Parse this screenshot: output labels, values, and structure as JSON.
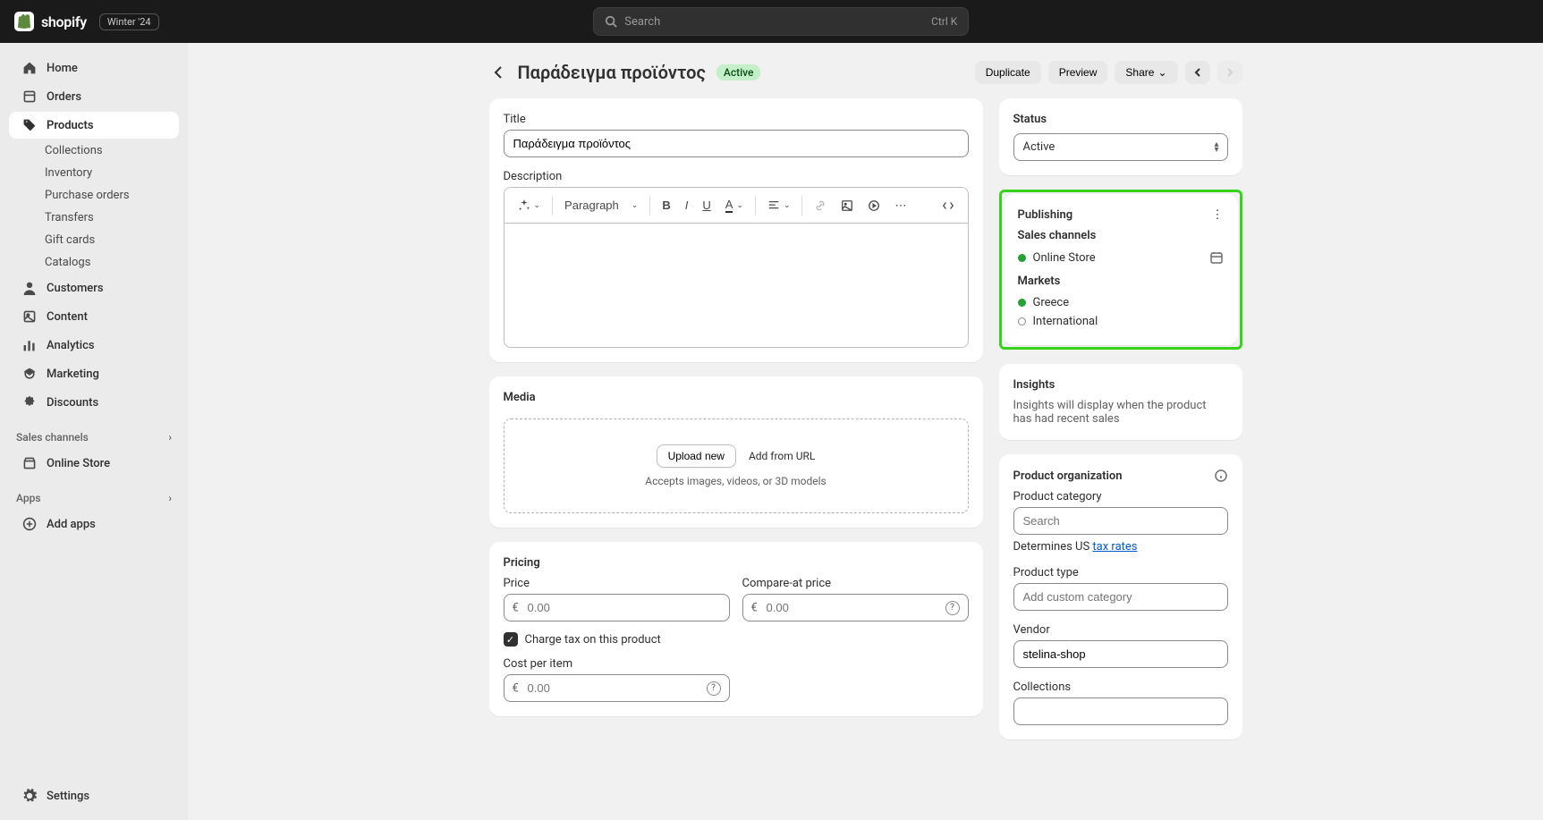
{
  "topbar": {
    "brand": "shopify",
    "version_pill": "Winter '24",
    "search_placeholder": "Search",
    "search_shortcut": "Ctrl K"
  },
  "sidebar": {
    "items": [
      {
        "label": "Home",
        "icon": "home"
      },
      {
        "label": "Orders",
        "icon": "orders"
      },
      {
        "label": "Products",
        "icon": "products",
        "active": true
      }
    ],
    "sub_items": [
      "Collections",
      "Inventory",
      "Purchase orders",
      "Transfers",
      "Gift cards",
      "Catalogs"
    ],
    "items2": [
      {
        "label": "Customers",
        "icon": "customers"
      },
      {
        "label": "Content",
        "icon": "content"
      },
      {
        "label": "Analytics",
        "icon": "analytics"
      },
      {
        "label": "Marketing",
        "icon": "marketing"
      },
      {
        "label": "Discounts",
        "icon": "discounts"
      }
    ],
    "sales_channels_label": "Sales channels",
    "online_store": "Online Store",
    "apps_label": "Apps",
    "add_apps": "Add apps",
    "settings": "Settings"
  },
  "page": {
    "title": "Παράδειγμα προϊόντος",
    "status_badge": "Active",
    "actions": {
      "duplicate": "Duplicate",
      "preview": "Preview",
      "share": "Share"
    }
  },
  "form": {
    "title_label": "Title",
    "title_value": "Παράδειγμα προϊόντος",
    "desc_label": "Description",
    "rte": {
      "paragraph": "Paragraph"
    },
    "media": {
      "heading": "Media",
      "upload": "Upload new",
      "from_url": "Add from URL",
      "hint": "Accepts images, videos, or 3D models"
    },
    "pricing": {
      "heading": "Pricing",
      "price_label": "Price",
      "compare_label": "Compare-at price",
      "currency": "€",
      "placeholder": "0.00",
      "charge_tax": "Charge tax on this product",
      "cost_label": "Cost per item"
    }
  },
  "side": {
    "status": {
      "heading": "Status",
      "value": "Active"
    },
    "publishing": {
      "heading": "Publishing",
      "sales_channels_label": "Sales channels",
      "channels": [
        {
          "name": "Online Store",
          "active": true
        }
      ],
      "markets_label": "Markets",
      "markets": [
        {
          "name": "Greece",
          "active": true
        },
        {
          "name": "International",
          "active": false
        }
      ]
    },
    "insights": {
      "heading": "Insights",
      "text": "Insights will display when the product has had recent sales"
    },
    "org": {
      "heading": "Product organization",
      "category_label": "Product category",
      "category_placeholder": "Search",
      "determines_prefix": "Determines US ",
      "tax_rates_link": "tax rates",
      "type_label": "Product type",
      "type_placeholder": "Add custom category",
      "vendor_label": "Vendor",
      "vendor_value": "stelina-shop",
      "collections_label": "Collections"
    }
  }
}
